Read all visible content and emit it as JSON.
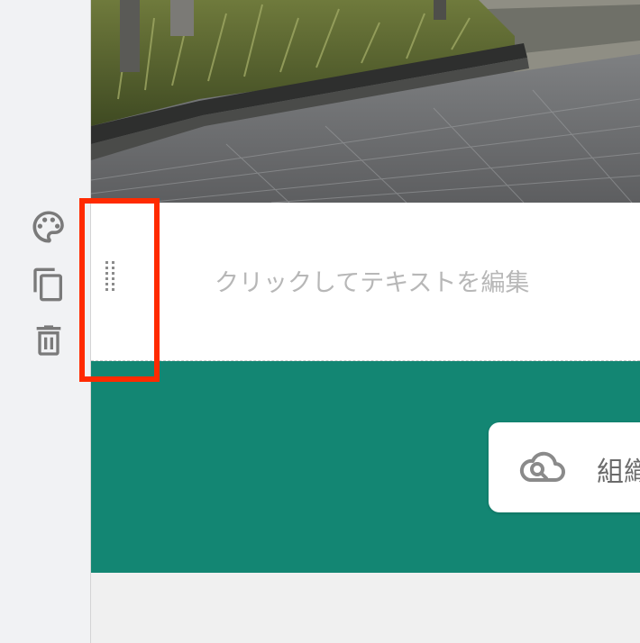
{
  "toolbar": {
    "items": [
      {
        "name": "palette",
        "icon": "palette-icon"
      },
      {
        "name": "duplicate",
        "icon": "copy-icon"
      },
      {
        "name": "delete",
        "icon": "trash-icon"
      }
    ]
  },
  "sections": {
    "text": {
      "placeholder": "クリックしてテキストを編集",
      "handle_icon": "drag-handle-icon"
    },
    "green": {
      "button_label": "組織",
      "button_icon": "cloud-search-icon"
    }
  },
  "colors": {
    "accent_green": "#138673",
    "highlight": "#ff2a00",
    "icon_gray": "#7a7a7a",
    "placeholder_text": "#b7b7b7"
  }
}
